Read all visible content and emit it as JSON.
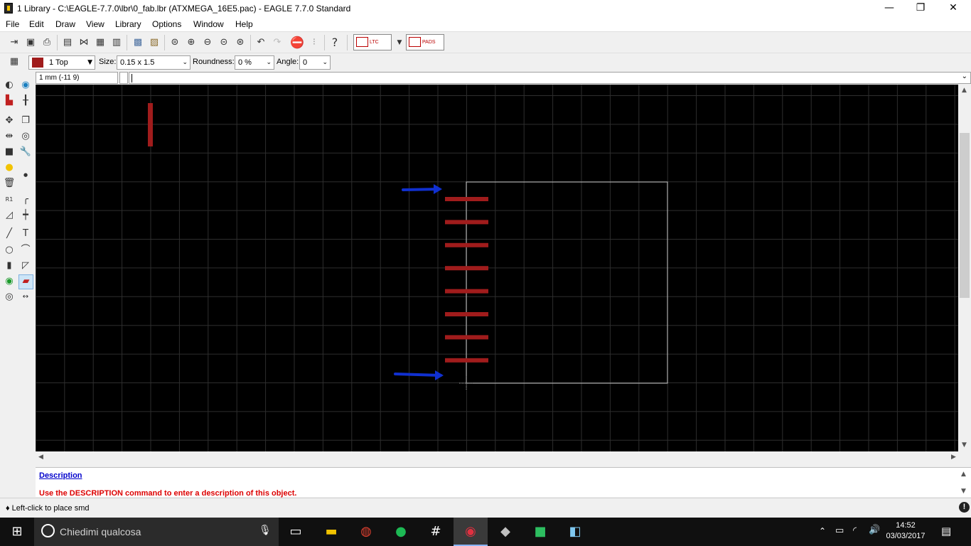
{
  "window": {
    "title": "1 Library - C:\\EAGLE-7.7.0\\lbr\\0_fab.lbr (ATXMEGA_16E5.pac) - EAGLE 7.7.0 Standard",
    "minimize": "—",
    "maximize": "❐",
    "close": "✕"
  },
  "menu": [
    "File",
    "Edit",
    "Draw",
    "View",
    "Library",
    "Options",
    "Window",
    "Help"
  ],
  "toolbar": {
    "ltspice_label": "LTC SPICE",
    "pads_label": "PADS",
    "icons": [
      "open-icon",
      "save-icon",
      "print-icon",
      "library-icon",
      "script-icon",
      "board-icon",
      "cam-icon",
      "zoom-fit-icon",
      "zoom-in-icon",
      "zoom-out-icon",
      "zoom-redraw-icon",
      "zoom-select-icon",
      "undo-icon",
      "redo-icon",
      "stop-icon",
      "go-icon",
      "help-icon"
    ]
  },
  "params": {
    "layer": "1 Top",
    "layer_color": "#a01c1c",
    "size_label": "Size:",
    "size_value": "0.15 x 1.5",
    "roundness_label": "Roundness:",
    "roundness_value": "0 %",
    "angle_label": "Angle:",
    "angle_value": "0"
  },
  "command": {
    "coordinates": "1 mm (-11 9)",
    "input_value": ""
  },
  "description": {
    "heading": "Description",
    "message": "Use the DESCRIPTION command to enter a description of this object."
  },
  "status": {
    "text": "♦ Left-click to place smd"
  },
  "taskbar": {
    "search_placeholder": "Chiedimi qualcosa",
    "time": "14:52",
    "date": "03/03/2017"
  },
  "colors": {
    "canvas_bg": "#000000",
    "grid": "#2e2e2e",
    "smd_pad": "#a01c1c",
    "outline": "#c8c8c8",
    "annotation_arrow": "#1030d0"
  }
}
